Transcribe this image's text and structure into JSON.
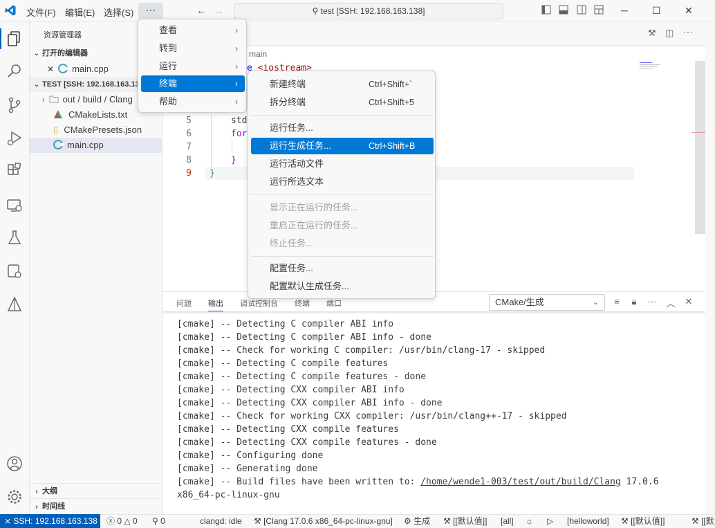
{
  "titlebar": {
    "menus": [
      "文件(F)",
      "编辑(E)",
      "选择(S)"
    ],
    "more": "···",
    "command_center": "test [SSH: 192.168.163.138]"
  },
  "sidebar": {
    "title": "资源管理器",
    "open_editors_header": "打开的编辑器",
    "open_editors": [
      {
        "close": "✕",
        "name": "main.cpp"
      }
    ],
    "workspace_header": "TEST [SSH: 192.168.163.138]",
    "tree": [
      {
        "name": "out / build / Clang",
        "type": "folder"
      },
      {
        "name": "CMakeLists.txt",
        "type": "cmake"
      },
      {
        "name": "CMakePresets.json",
        "type": "json"
      },
      {
        "name": "main.cpp",
        "type": "cpp"
      }
    ],
    "outline_header": "大纲",
    "timeline_header": "时间线"
  },
  "editor": {
    "breadcrumb": "main",
    "code_include_prefix": "e ",
    "code_include": "<iostream>",
    "lines": [
      {
        "num": "5",
        "text": "std"
      },
      {
        "num": "6",
        "text": "for"
      },
      {
        "num": "7",
        "text": ""
      },
      {
        "num": "8",
        "text": "}"
      },
      {
        "num": "9",
        "text": "}"
      }
    ]
  },
  "panel": {
    "tabs": [
      "问题",
      "输出",
      "调试控制台",
      "终端",
      "端口"
    ],
    "active_tab": "输出",
    "channel": "CMake/生成",
    "output": [
      "[cmake] -- Detecting C compiler ABI info",
      "[cmake] -- Detecting C compiler ABI info - done",
      "[cmake] -- Check for working C compiler: /usr/bin/clang-17 - skipped",
      "[cmake] -- Detecting C compile features",
      "[cmake] -- Detecting C compile features - done",
      "[cmake] -- Detecting CXX compiler ABI info",
      "[cmake] -- Detecting CXX compiler ABI info - done",
      "[cmake] -- Check for working CXX compiler: /usr/bin/clang++-17 - skipped",
      "[cmake] -- Detecting CXX compile features",
      "[cmake] -- Detecting CXX compile features - done",
      "[cmake] -- Configuring done",
      "[cmake] -- Generating done"
    ],
    "build_line_prefix": "[cmake] -- Build files have been written to: ",
    "build_line_path": "/home/wende1-003/test/out/build/Clang",
    "build_line_suffix": " 17.0.6",
    "build_line_wrap": "x86_64-pc-linux-gnu"
  },
  "menu_main": {
    "items": [
      {
        "label": "查看"
      },
      {
        "label": "转到"
      },
      {
        "label": "运行"
      },
      {
        "label": "终端",
        "highlighted": true
      },
      {
        "label": "帮助"
      }
    ]
  },
  "menu_terminal": {
    "items": [
      {
        "label": "新建终端",
        "shortcut": "Ctrl+Shift+`"
      },
      {
        "label": "拆分终端",
        "shortcut": "Ctrl+Shift+5"
      },
      {
        "label": "运行任务..."
      },
      {
        "label": "运行生成任务...",
        "shortcut": "Ctrl+Shift+B",
        "highlighted": true
      },
      {
        "label": "运行活动文件"
      },
      {
        "label": "运行所选文本"
      },
      {
        "label": "显示正在运行的任务...",
        "disabled": true
      },
      {
        "label": "重启正在运行的任务...",
        "disabled": true
      },
      {
        "label": "终止任务...",
        "disabled": true
      },
      {
        "label": "配置任务..."
      },
      {
        "label": "配置默认生成任务..."
      }
    ]
  },
  "statusbar": {
    "remote": "SSH: 192.168.163.138",
    "errors": "0",
    "warnings": "0",
    "ports": "0",
    "clangd": "clangd: idle",
    "kit": "[Clang 17.0.6 x86_64-pc-linux-gnu]",
    "build": "生成",
    "default_target": "[[默认值]]",
    "all": "[all]",
    "launch_target": "[helloworld]",
    "default_target2": "[[默"
  },
  "colors": {
    "accent": "#005fb8",
    "menu_highlight": "#0079d6"
  }
}
